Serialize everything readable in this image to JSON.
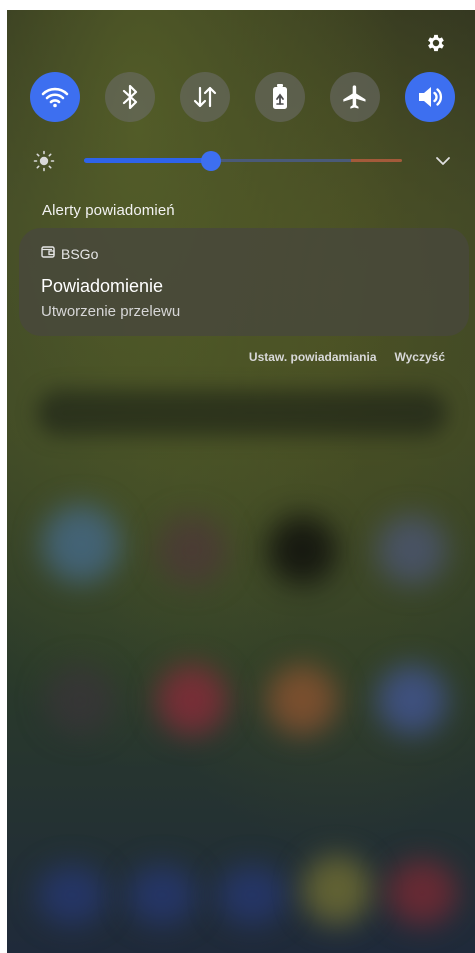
{
  "quick_settings": {
    "settings_icon": "gear-icon",
    "toggles": [
      {
        "name": "wifi",
        "icon": "wifi-icon",
        "state": "on"
      },
      {
        "name": "bluetooth",
        "icon": "bluetooth-icon",
        "state": "off"
      },
      {
        "name": "mobile-data",
        "icon": "data-transfer-icon",
        "state": "off"
      },
      {
        "name": "power-saving",
        "icon": "battery-saver-icon",
        "state": "off"
      },
      {
        "name": "airplane-mode",
        "icon": "airplane-icon",
        "state": "off"
      },
      {
        "name": "sound",
        "icon": "speaker-icon",
        "state": "on"
      }
    ],
    "brightness": {
      "icon": "brightness-sun-icon",
      "level": 0.4,
      "expand_icon": "chevron-down-icon"
    }
  },
  "notifications": {
    "section_title": "Alerty powiadomień",
    "items": [
      {
        "app_name": "BSGo",
        "app_icon": "wallet-icon",
        "title": "Powiadomienie",
        "body": "Utworzenie przelewu"
      }
    ],
    "actions": {
      "settings_label": "Ustaw. powiadamiania",
      "clear_label": "Wyczyść"
    }
  },
  "colors": {
    "accent": "#3d6ff0",
    "toggle_off": "#6e6e6e",
    "card": "#48483c"
  }
}
